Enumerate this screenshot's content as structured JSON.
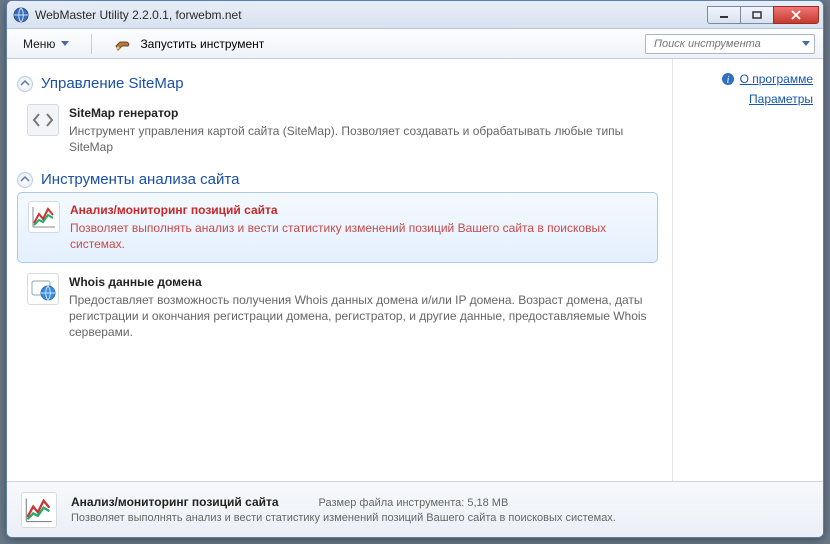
{
  "window": {
    "title": "WebMaster Utility 2.2.0.1, forwebm.net"
  },
  "toolbar": {
    "menu_label": "Меню",
    "run_label": "Запустить инструмент",
    "search_placeholder": "Поиск инструмента"
  },
  "sidebar": {
    "about_label": "О программе",
    "settings_label": "Параметры"
  },
  "sections": [
    {
      "title": "Управление SiteMap",
      "items": [
        {
          "title": "SiteMap генератор",
          "desc": "Инструмент управления картой сайта (SiteMap). Позволяет создавать и обрабатывать любые типы SiteMap",
          "icon": "code-icon",
          "selected": false
        }
      ]
    },
    {
      "title": "Инструменты анализа сайта",
      "items": [
        {
          "title": "Анализ/мониторинг позиций сайта",
          "desc": "Позволяет выполнять анализ и вести статистику изменений позиций Вашего сайта в поисковых системах.",
          "icon": "chart-icon",
          "selected": true
        },
        {
          "title": "Whois данные домена",
          "desc": "Предоставляет возможность получения Whois данных домена и/или IP домена. Возраст домена, даты регистрации и окончания регистрации домена, регистратор, и другие данные, предоставляемые Whois серверами.",
          "icon": "whois-icon",
          "selected": false
        }
      ]
    }
  ],
  "footer": {
    "title": "Анализ/мониторинг позиций сайта",
    "size_label": "Размер файла инструмента: 5,18 MB",
    "desc": "Позволяет выполнять анализ и вести статистику изменений позиций Вашего сайта в поисковых системах."
  }
}
